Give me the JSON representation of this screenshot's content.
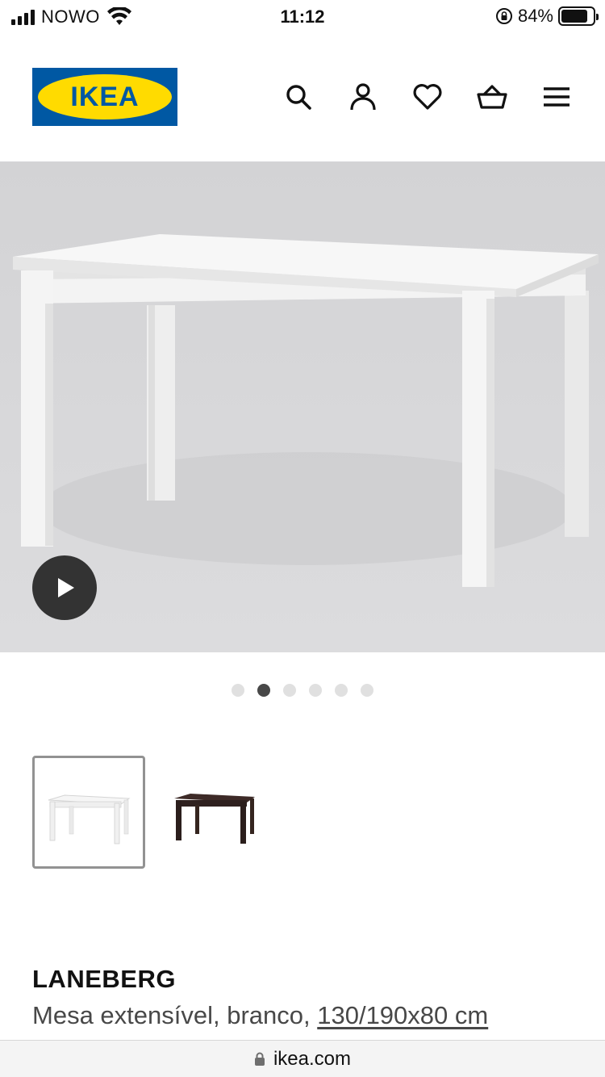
{
  "status_bar": {
    "carrier": "NOWO",
    "time": "11:12",
    "battery_percent": "84%",
    "battery_level": 0.84,
    "icons": [
      "signal-icon",
      "wifi-icon",
      "rotation-lock-icon",
      "battery-icon"
    ]
  },
  "header": {
    "logo_text": "IKEA",
    "brand_colors": {
      "blue": "#0058a3",
      "yellow": "#ffdb00"
    },
    "icons": [
      "search-icon",
      "account-icon",
      "heart-icon",
      "basket-icon",
      "menu-icon"
    ]
  },
  "hero": {
    "play_icon": "play-icon"
  },
  "carousel": {
    "total": 6,
    "active_index": 1
  },
  "variants": [
    {
      "color": "white",
      "selected": true
    },
    {
      "color": "dark-brown",
      "selected": false
    }
  ],
  "product": {
    "name": "LANEBERG",
    "description_prefix": "Mesa extensível, branco, ",
    "dimensions": "130/190x80 cm"
  },
  "address_bar": {
    "url": "ikea.com",
    "icon": "lock-icon"
  }
}
